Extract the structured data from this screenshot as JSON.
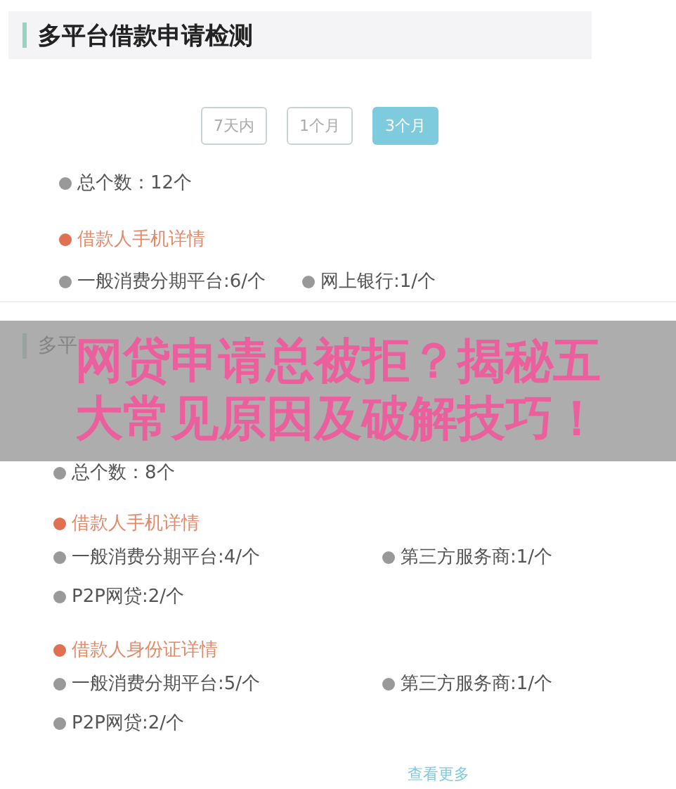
{
  "sections": [
    {
      "title": "多平台借款申请检测",
      "kind": "row",
      "tabs": [
        {
          "label": "7天内",
          "selected": false
        },
        {
          "label": "1个月",
          "selected": false
        },
        {
          "label": "3个月",
          "selected": true
        }
      ],
      "total": "总个数：12个",
      "groups": [
        {
          "title": "借款人手机详情",
          "items": [
            "一般消费分期平台:6/个",
            "网上银行:1/个"
          ]
        }
      ]
    },
    {
      "title": "多平",
      "kind": "grid",
      "total": "总个数：8个",
      "groups": [
        {
          "title": "借款人手机详情",
          "items": [
            "一般消费分期平台:4/个",
            "第三方服务商:1/个",
            "P2P网贷:2/个"
          ]
        },
        {
          "title": "借款人身份证详情",
          "items": [
            "一般消费分期平台:5/个",
            "第三方服务商:1/个",
            "P2P网贷:2/个"
          ]
        }
      ],
      "more": "查看更多"
    }
  ],
  "overlay": {
    "headline": "网贷申请总被拒？揭秘五大常见原因及破解技巧！"
  }
}
